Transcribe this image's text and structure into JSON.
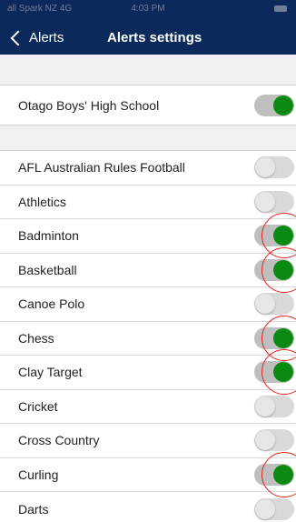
{
  "status_bar": {
    "carrier": "all Spark NZ 4G",
    "time": "4:03 PM"
  },
  "nav": {
    "back_label": "Alerts",
    "title": "Alerts settings"
  },
  "school": {
    "label": "Otago Boys'  High School",
    "enabled": true
  },
  "sports": [
    {
      "label": "AFL Australian Rules Football",
      "enabled": false,
      "circled": false
    },
    {
      "label": "Athletics",
      "enabled": false,
      "circled": false
    },
    {
      "label": "Badminton",
      "enabled": true,
      "circled": true
    },
    {
      "label": "Basketball",
      "enabled": true,
      "circled": true
    },
    {
      "label": "Canoe Polo",
      "enabled": false,
      "circled": false
    },
    {
      "label": "Chess",
      "enabled": true,
      "circled": true
    },
    {
      "label": "Clay Target",
      "enabled": true,
      "circled": true
    },
    {
      "label": "Cricket",
      "enabled": false,
      "circled": false
    },
    {
      "label": "Cross Country",
      "enabled": false,
      "circled": false
    },
    {
      "label": "Curling",
      "enabled": true,
      "circled": true
    },
    {
      "label": "Darts",
      "enabled": false,
      "circled": false
    }
  ],
  "colors": {
    "header": "#0b2a5b",
    "toggle_on_knob": "#0b8a12",
    "annotation": "#e2231a"
  }
}
